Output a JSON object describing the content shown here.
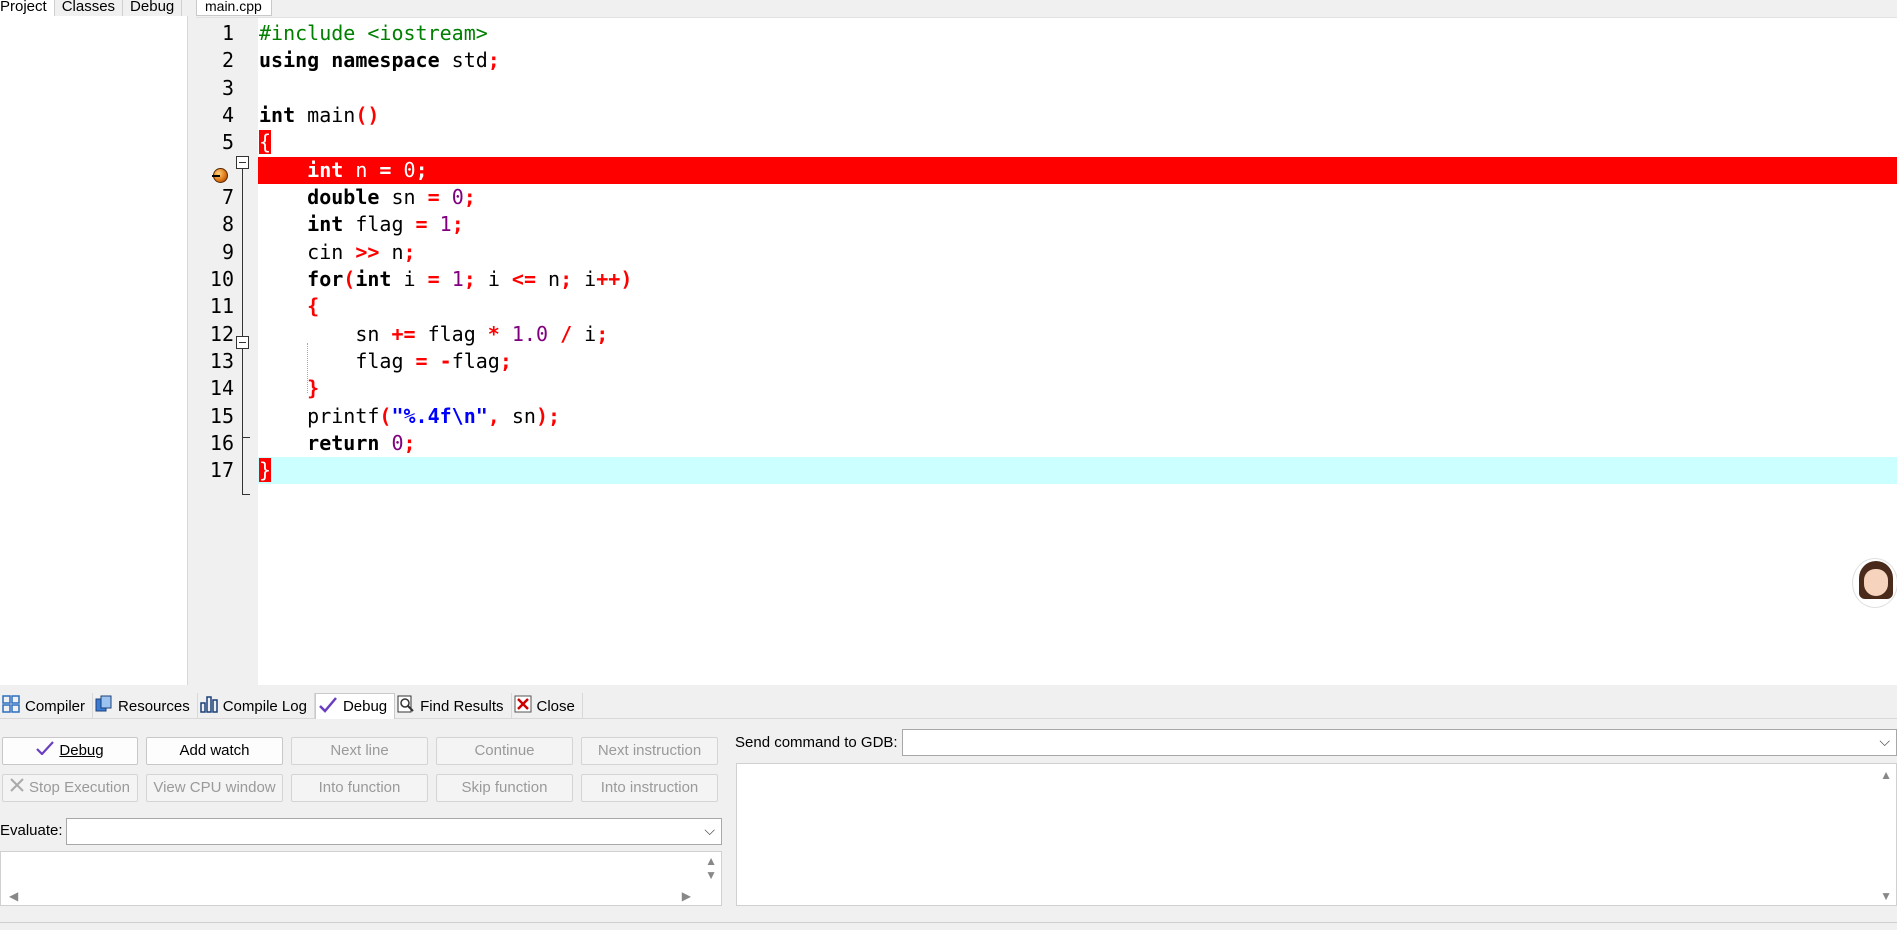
{
  "left_tabs": [
    {
      "label": "Project",
      "active": true
    },
    {
      "label": "Classes",
      "active": false
    },
    {
      "label": "Debug",
      "active": false
    }
  ],
  "editor": {
    "file_tab": "main.cpp",
    "line_numbers": [
      "1",
      "2",
      "3",
      "4",
      "5",
      "6",
      "7",
      "8",
      "9",
      "10",
      "11",
      "12",
      "13",
      "14",
      "15",
      "16",
      "17"
    ],
    "breakpoint_line": 6,
    "current_line": 17,
    "colors": {
      "exec_line": "#ff0000",
      "current_line": "#ccffff"
    }
  },
  "code": [
    [
      {
        "t": "#include <iostream>",
        "c": "pp"
      }
    ],
    [
      {
        "t": "using namespace",
        "c": "kw"
      },
      {
        "t": " std",
        "c": "plain"
      },
      {
        "t": ";",
        "c": "sym"
      }
    ],
    [],
    [
      {
        "t": "int",
        "c": "kw"
      },
      {
        "t": " main",
        "c": "plain"
      },
      {
        "t": "()",
        "c": "sym"
      }
    ],
    [
      {
        "t": "{",
        "c": "br-hl"
      }
    ],
    [
      {
        "t": "    ",
        "c": "plain"
      },
      {
        "t": "int",
        "c": "kw"
      },
      {
        "t": " n ",
        "c": "plain"
      },
      {
        "t": "=",
        "c": "sym"
      },
      {
        "t": " ",
        "c": "plain"
      },
      {
        "t": "0",
        "c": "num"
      },
      {
        "t": ";",
        "c": "sym"
      }
    ],
    [
      {
        "t": "    ",
        "c": "plain"
      },
      {
        "t": "double",
        "c": "kw"
      },
      {
        "t": " sn ",
        "c": "plain"
      },
      {
        "t": "=",
        "c": "sym"
      },
      {
        "t": " ",
        "c": "plain"
      },
      {
        "t": "0",
        "c": "num"
      },
      {
        "t": ";",
        "c": "sym"
      }
    ],
    [
      {
        "t": "    ",
        "c": "plain"
      },
      {
        "t": "int",
        "c": "kw"
      },
      {
        "t": " flag ",
        "c": "plain"
      },
      {
        "t": "=",
        "c": "sym"
      },
      {
        "t": " ",
        "c": "plain"
      },
      {
        "t": "1",
        "c": "num"
      },
      {
        "t": ";",
        "c": "sym"
      }
    ],
    [
      {
        "t": "    cin ",
        "c": "plain"
      },
      {
        "t": ">>",
        "c": "sym"
      },
      {
        "t": " n",
        "c": "plain"
      },
      {
        "t": ";",
        "c": "sym"
      }
    ],
    [
      {
        "t": "    ",
        "c": "plain"
      },
      {
        "t": "for",
        "c": "kw"
      },
      {
        "t": "(",
        "c": "sym"
      },
      {
        "t": "int",
        "c": "kw"
      },
      {
        "t": " i ",
        "c": "plain"
      },
      {
        "t": "=",
        "c": "sym"
      },
      {
        "t": " ",
        "c": "plain"
      },
      {
        "t": "1",
        "c": "num"
      },
      {
        "t": ";",
        "c": "sym"
      },
      {
        "t": " i ",
        "c": "plain"
      },
      {
        "t": "<=",
        "c": "sym"
      },
      {
        "t": " n",
        "c": "plain"
      },
      {
        "t": ";",
        "c": "sym"
      },
      {
        "t": " i",
        "c": "plain"
      },
      {
        "t": "++)",
        "c": "sym"
      }
    ],
    [
      {
        "t": "    ",
        "c": "plain"
      },
      {
        "t": "{",
        "c": "sym"
      }
    ],
    [
      {
        "t": "        sn ",
        "c": "plain"
      },
      {
        "t": "+=",
        "c": "sym"
      },
      {
        "t": " flag ",
        "c": "plain"
      },
      {
        "t": "*",
        "c": "sym"
      },
      {
        "t": " ",
        "c": "plain"
      },
      {
        "t": "1.0",
        "c": "num"
      },
      {
        "t": " ",
        "c": "plain"
      },
      {
        "t": "/",
        "c": "sym"
      },
      {
        "t": " i",
        "c": "plain"
      },
      {
        "t": ";",
        "c": "sym"
      }
    ],
    [
      {
        "t": "        flag ",
        "c": "plain"
      },
      {
        "t": "=",
        "c": "sym"
      },
      {
        "t": " ",
        "c": "plain"
      },
      {
        "t": "-",
        "c": "sym"
      },
      {
        "t": "flag",
        "c": "plain"
      },
      {
        "t": ";",
        "c": "sym"
      }
    ],
    [
      {
        "t": "    ",
        "c": "plain"
      },
      {
        "t": "}",
        "c": "sym"
      }
    ],
    [
      {
        "t": "    printf",
        "c": "plain"
      },
      {
        "t": "(",
        "c": "sym"
      },
      {
        "t": "\"%.4f\\n\"",
        "c": "str"
      },
      {
        "t": ",",
        "c": "sym"
      },
      {
        "t": " sn",
        "c": "plain"
      },
      {
        "t": ");",
        "c": "sym"
      }
    ],
    [
      {
        "t": "    ",
        "c": "plain"
      },
      {
        "t": "return",
        "c": "kw"
      },
      {
        "t": " ",
        "c": "plain"
      },
      {
        "t": "0",
        "c": "num"
      },
      {
        "t": ";",
        "c": "sym"
      }
    ],
    [
      {
        "t": "}",
        "c": "br-hl"
      }
    ]
  ],
  "bottom_tabs": [
    {
      "label": "Compiler",
      "icon": "compiler-grid-icon",
      "active": false
    },
    {
      "label": "Resources",
      "icon": "resources-icon",
      "active": false
    },
    {
      "label": "Compile Log",
      "icon": "bar-chart-icon",
      "active": false
    },
    {
      "label": "Debug",
      "icon": "checkmark-icon",
      "active": true
    },
    {
      "label": "Find Results",
      "icon": "magnifier-doc-icon",
      "active": false
    },
    {
      "label": "Close",
      "icon": "close-x-icon",
      "active": false
    }
  ],
  "debug": {
    "buttons": {
      "debug": "Debug",
      "add_watch": "Add watch",
      "next_line": "Next line",
      "continue": "Continue",
      "next_instruction": "Next instruction",
      "stop_execution": "Stop Execution",
      "view_cpu": "View CPU window",
      "into_function": "Into function",
      "skip_function": "Skip function",
      "into_instruction": "Into instruction"
    },
    "evaluate_label": "Evaluate:",
    "evaluate_value": "",
    "gdb_label": "Send command to GDB:",
    "gdb_value": ""
  }
}
